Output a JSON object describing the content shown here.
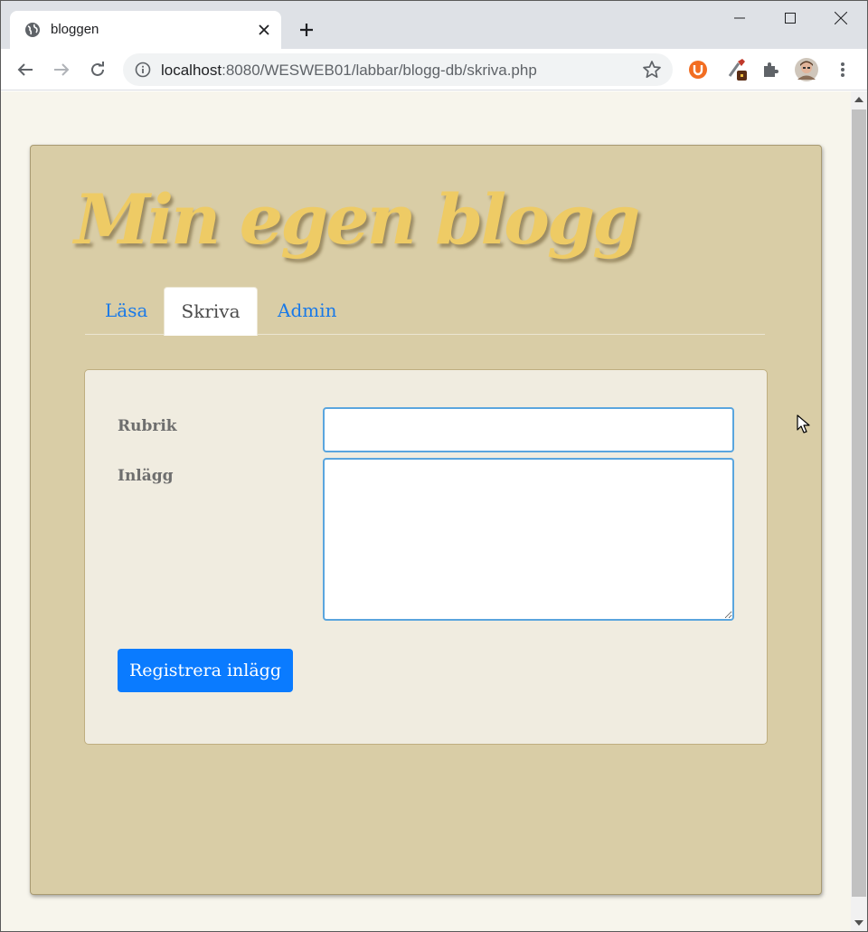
{
  "browser": {
    "tab_title": "bloggen",
    "url_host": "localhost",
    "url_path": ":8080/WESWEB01/labbar/blogg-db/skriva.php"
  },
  "page": {
    "blog_title": "Min egen blogg",
    "nav": {
      "lasa": "Läsa",
      "skriva": "Skriva",
      "admin": "Admin"
    },
    "form": {
      "rubrik_label": "Rubrik",
      "rubrik_value": "",
      "inlagg_label": "Inlägg",
      "inlagg_value": "",
      "submit_label": "Registrera inlägg"
    }
  },
  "colors": {
    "card_bg": "#d9cda6",
    "title_color": "#eecb65",
    "link_color": "#1a7ae8",
    "button_color": "#0a7bff",
    "input_border": "#5aa5de"
  },
  "icons": [
    "globe-icon",
    "close-icon",
    "plus-icon",
    "minimize-icon",
    "maximize-icon",
    "window-close-icon",
    "back-arrow-icon",
    "forward-arrow-icon",
    "reload-icon",
    "info-icon",
    "star-icon",
    "ublock-icon",
    "eyedropper-icon",
    "puzzle-icon",
    "avatar",
    "kebab-menu-icon",
    "mouse-cursor-icon"
  ]
}
